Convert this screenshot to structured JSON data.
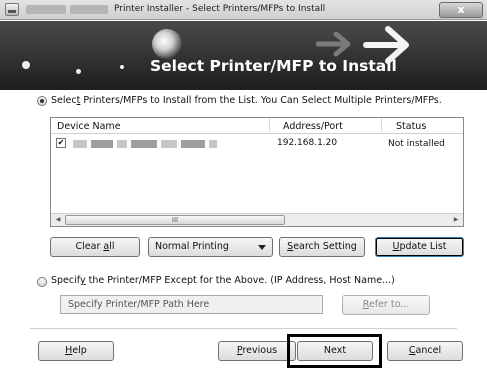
{
  "window": {
    "title": "Printer Installer - Select Printers/MFPs to Install",
    "close_glyph": "x"
  },
  "banner": {
    "heading": "Select Printer/MFP to Install"
  },
  "option_list": {
    "label_pre": "Selec",
    "label_key": "t",
    "label_post": " Printers/MFPs to Install from the List. You Can Select Multiple Printers/MFPs.",
    "selected": true
  },
  "device_list": {
    "columns": [
      "Device Name",
      "Address/Port",
      "Status"
    ],
    "rows": [
      {
        "checked": true,
        "check_glyph": "✔",
        "address": "192.168.1.20",
        "status": "Not installed"
      }
    ],
    "scroll_thumb_glyph": "III"
  },
  "actions": {
    "clear_all_pre": "Clear ",
    "clear_all_key": "a",
    "clear_all_post": "ll",
    "print_mode": "Normal Printing",
    "search_key": "S",
    "search_post": "earch Setting",
    "update_key": "U",
    "update_post": "pdate List"
  },
  "option_specify": {
    "label_pre": "Specif",
    "label_key": "y",
    "label_post": " the Printer/MFP Except for the Above. (IP Address, Host Name...)",
    "selected": false,
    "path_placeholder": "Specify Printer/MFP Path Here",
    "refer_key": "R",
    "refer_post": "efer to..."
  },
  "footer": {
    "help_key": "H",
    "help_post": "elp",
    "previous_key": "P",
    "previous_post": "revious",
    "next": "Next",
    "cancel_key": "C",
    "cancel_post": "ancel"
  }
}
